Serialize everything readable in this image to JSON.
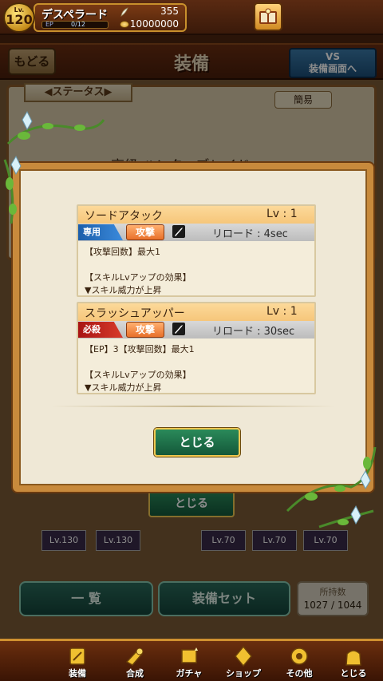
{
  "player": {
    "level_prefix": "Lv.",
    "level": "120",
    "name": "デスペラード",
    "ep_label": "EP",
    "ep_value": "0/12",
    "feathers": "355",
    "gold": "10000000"
  },
  "header": {
    "back_label": "もどる",
    "title": "装備",
    "vs_line1": "VS",
    "vs_line2": "装備画面へ"
  },
  "background": {
    "status_tab": "◀ステータス▶",
    "simple_label": "簡易",
    "item_name": "高級 ハンターブレイド",
    "close_label": "とじる",
    "thumbs": [
      "Lv.130",
      "Lv.130",
      "Lv.70",
      "Lv.70",
      "Lv.70"
    ],
    "list_label": "一 覧",
    "equip_set_label": "装備セット",
    "owned_label": "所持数",
    "owned_value": "1027 / 1044"
  },
  "modal": {
    "skills": [
      {
        "name": "ソードアタック",
        "level": "Lv : 1",
        "type": "専用",
        "type_color": "#1c5eaa",
        "attack_tag": "攻撃",
        "reload": "リロード : 4sec",
        "effect": "【攻撃回数】最大1",
        "up_title": "【スキルLvアップの効果】",
        "up_effect": "▼スキル威力が上昇"
      },
      {
        "name": "スラッシュアッパー",
        "level": "Lv : 1",
        "type": "必殺",
        "type_color": "#a81414",
        "attack_tag": "攻撃",
        "reload": "リロード : 30sec",
        "effect": "【EP】3【攻撃回数】最大1",
        "up_title": "【スキルLvアップの効果】",
        "up_effect": "▼スキル威力が上昇"
      }
    ],
    "close_label": "とじる"
  },
  "nav": [
    {
      "label": "装備",
      "icon": "equip-icon"
    },
    {
      "label": "合成",
      "icon": "synthesis-icon"
    },
    {
      "label": "ガチャ",
      "icon": "gacha-icon"
    },
    {
      "label": "ショップ",
      "icon": "shop-icon"
    },
    {
      "label": "その他",
      "icon": "gear-icon"
    },
    {
      "label": "とじる",
      "icon": "close-bag-icon"
    }
  ]
}
